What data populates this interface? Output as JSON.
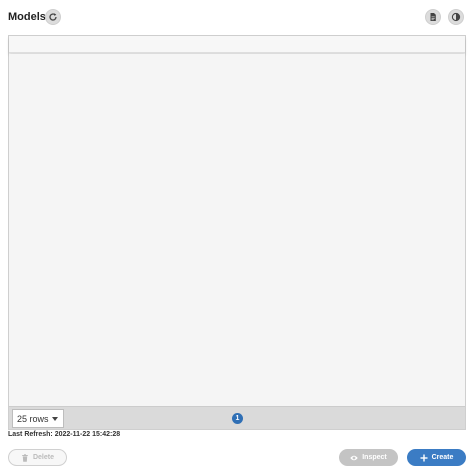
{
  "header": {
    "title": "Models",
    "refresh_icon": "refresh-icon",
    "doc_icon": "document-icon",
    "contrast_icon": "contrast-icon"
  },
  "table": {
    "columns": [],
    "rows": [],
    "footer": {
      "rows_per_page": "25 rows",
      "current_page": "1"
    }
  },
  "status": {
    "last_refresh_label": "Last Refresh:",
    "last_refresh_value": "2022-11-22 15:42:28"
  },
  "actions": {
    "delete_label": "Delete",
    "inspect_label": "Inspect",
    "create_label": "Create"
  },
  "colors": {
    "primary": "#3b7cc4",
    "page_indicator": "#2f6fb5",
    "disabled": "#c4c4c4"
  }
}
